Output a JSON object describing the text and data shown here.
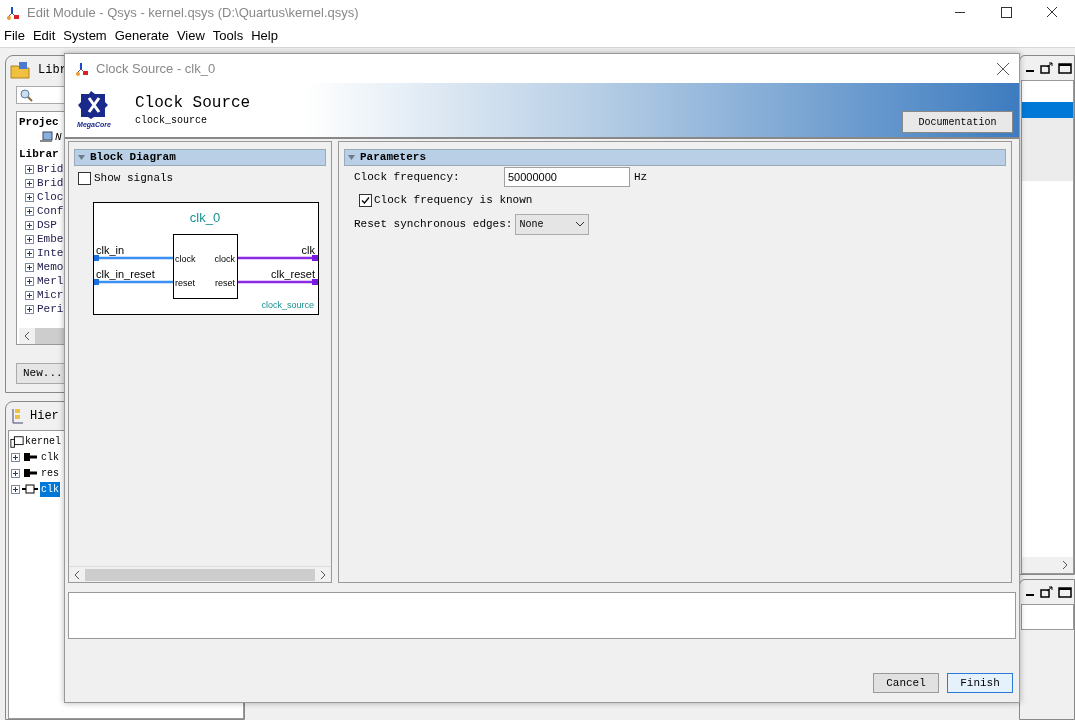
{
  "main_window": {
    "title": "Edit Module - Qsys - kernel.qsys (D:\\Quartus\\kernel.qsys)",
    "menu": [
      "File",
      "Edit",
      "System",
      "Generate",
      "View",
      "Tools",
      "Help"
    ]
  },
  "library_panel": {
    "title": "Libr",
    "project_heading": "Projec",
    "project_items": [
      "N"
    ],
    "library_heading": "Librar",
    "items": [
      "Brid",
      "Brid",
      "Cloc",
      "Conf",
      "DSP",
      "Embe",
      "Inte",
      "Memo",
      "Merl",
      "Micr",
      "Peri"
    ],
    "new_button": "New..."
  },
  "hierarchy_panel": {
    "title": "Hier",
    "root": "kernel",
    "children": [
      {
        "label": "clk",
        "kind": "port",
        "selected": false
      },
      {
        "label": "res",
        "kind": "port",
        "selected": false
      },
      {
        "label": "clk",
        "kind": "module",
        "selected": true
      }
    ]
  },
  "dialog": {
    "title": "Clock Source - clk_0",
    "logo_text": "MegaCore",
    "name": "Clock Source",
    "type": "clock_source",
    "doc_button": "Documentation",
    "block_panel": {
      "title": "Block Diagram",
      "expanded": true,
      "show_signals": {
        "label": "Show signals",
        "checked": false
      },
      "diagram": {
        "instance": "clk_0",
        "component": "clock_source",
        "inputs": [
          {
            "signal": "clk_in",
            "port": "clock"
          },
          {
            "signal": "clk_in_reset",
            "port": "reset"
          }
        ],
        "outputs": [
          {
            "port": "clock",
            "signal": "clk"
          },
          {
            "port": "reset",
            "signal": "clk_reset"
          }
        ]
      }
    },
    "parameters": {
      "title": "Parameters",
      "expanded": true,
      "fields": [
        {
          "kind": "text",
          "label": "Clock frequency:",
          "value": "50000000",
          "unit": "Hz"
        },
        {
          "kind": "checkbox",
          "label": "Clock frequency is known",
          "checked": true
        },
        {
          "kind": "select",
          "label": "Reset synchronous edges:",
          "value": "None"
        }
      ]
    },
    "buttons": [
      {
        "label": "Cancel",
        "default": false
      },
      {
        "label": "Finish",
        "default": true
      }
    ]
  }
}
